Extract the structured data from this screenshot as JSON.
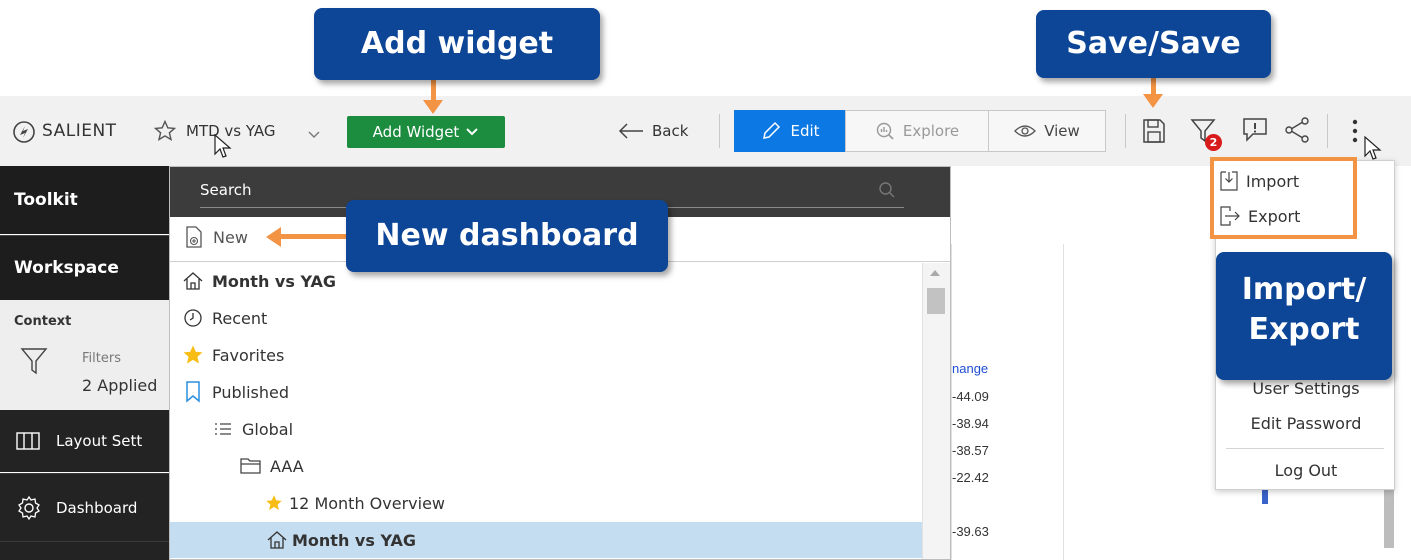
{
  "callouts": {
    "add_widget": "Add widget",
    "save": "Save/Save",
    "new_dashboard": "New dashboard",
    "import_export_line1": "Import/",
    "import_export_line2": "Export"
  },
  "header": {
    "brand": "SALIENT",
    "dashboard_name": "MTD vs YAG",
    "add_widget_label": "Add Widget",
    "back_label": "Back",
    "modes": [
      {
        "label": "Edit",
        "active": true
      },
      {
        "label": "Explore",
        "active": false
      },
      {
        "label": "View",
        "active": false
      }
    ],
    "filter_badge": "2"
  },
  "sidebar": {
    "toolkit": "Toolkit",
    "workspace": "Workspace",
    "context": "Context",
    "filters_label": "Filters",
    "filters_value": "2 Applied",
    "layout_label": "Layout Sett",
    "dashboard_label": "Dashboard"
  },
  "dropdown": {
    "search_placeholder": "Search",
    "new_label": "New",
    "items": [
      {
        "label": "Month vs YAG",
        "icon": "home-icon",
        "bold": true
      },
      {
        "label": "Recent",
        "icon": "clock-icon",
        "bold": false
      },
      {
        "label": "Favorites",
        "icon": "star-icon",
        "bold": false
      },
      {
        "label": "Published",
        "icon": "bookmark-icon",
        "bold": false
      },
      {
        "label": "Global",
        "icon": "list-icon",
        "bold": false
      },
      {
        "label": "AAA",
        "icon": "folder-icon",
        "bold": false
      },
      {
        "label": "12 Month Overview",
        "icon": "star-icon",
        "bold": false
      },
      {
        "label": "Month vs YAG",
        "icon": "home-icon",
        "bold": true
      }
    ]
  },
  "background_table": {
    "header": "nange",
    "values": [
      "-44.09",
      "-38.94",
      "-38.57",
      "-22.42",
      "-39.63"
    ]
  },
  "menu": {
    "import": "Import",
    "export": "Export",
    "user_settings": "User Settings",
    "edit_password": "Edit Password",
    "log_out": "Log Out"
  },
  "colors": {
    "callout": "#0d4597",
    "arrow": "#f39344",
    "add_widget_button": "#1c8c3f",
    "edit_active": "#0b78e3",
    "sidebar_dark": "#1d1d1d",
    "selected_row": "#c5ddf0"
  }
}
